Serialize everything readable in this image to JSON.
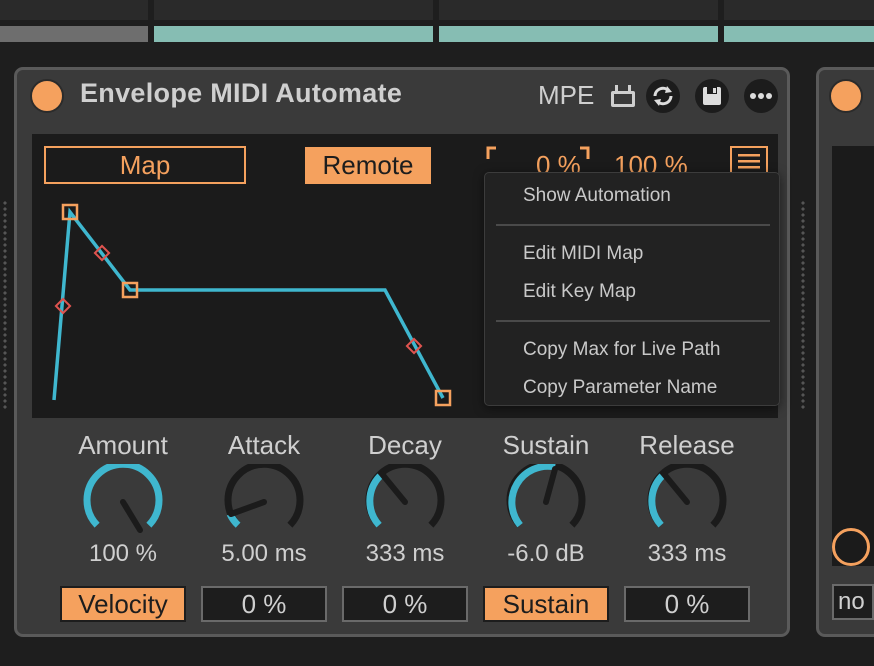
{
  "device": {
    "title": "Envelope MIDI Automate",
    "mpe_label": "MPE",
    "map_label": "Map",
    "remote_label": "Remote",
    "range_min": "0 %",
    "range_max": "100 %"
  },
  "colors": {
    "accent": "#f5a15e",
    "envelope_line": "#3fb7cf",
    "breakpoint_marker": "#e0534f",
    "teal_strip": "#86bdb3",
    "device_bg": "#3a3a3a"
  },
  "context_menu": {
    "items": [
      {
        "label": "Show Automation"
      },
      {
        "label": "Edit MIDI Map"
      },
      {
        "label": "Edit Key Map"
      },
      {
        "label": "Copy Max for Live Path"
      },
      {
        "label": "Copy Parameter Name"
      }
    ]
  },
  "knobs": [
    {
      "label": "Amount",
      "value": "100 %",
      "button": "Velocity",
      "button_on": true
    },
    {
      "label": "Attack",
      "value": "5.00 ms",
      "button": "0 %",
      "button_on": false
    },
    {
      "label": "Decay",
      "value": "333 ms",
      "button": "0 %",
      "button_on": false
    },
    {
      "label": "Sustain",
      "value": "-6.0 dB",
      "button": "Sustain",
      "button_on": true
    },
    {
      "label": "Release",
      "value": "333 ms",
      "button": "0 %",
      "button_on": false
    }
  ],
  "right_device": {
    "partial_label": "no"
  }
}
